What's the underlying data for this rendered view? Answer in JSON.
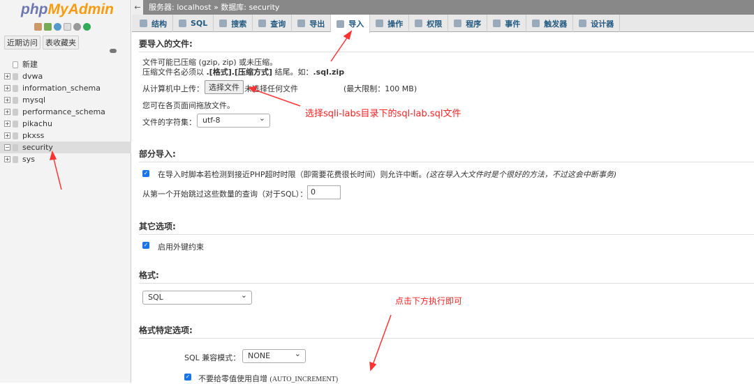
{
  "sidebar": {
    "logo_a": "php",
    "logo_b": "MyAdmin",
    "recent": "近期访问",
    "favorites": "表收藏夹",
    "tree": [
      "新建",
      "dvwa",
      "information_schema",
      "mysql",
      "performance_schema",
      "pikachu",
      "pkxss",
      "security",
      "sys"
    ],
    "selected": "security"
  },
  "topbar": {
    "crumb": "服务器: localhost » 数据库: security"
  },
  "tabs": [
    "结构",
    "SQL",
    "搜索",
    "查询",
    "导出",
    "导入",
    "操作",
    "权限",
    "程序",
    "事件",
    "触发器",
    "设计器"
  ],
  "active_tab": "导入",
  "file_section": {
    "heading": "要导入的文件:",
    "line1": "文件可能已压缩 (gzip, zip) 或未压缩。",
    "line2_a": "压缩文件名必须以 ",
    "line2_b": ".[格式].[压缩方式]",
    "line2_c": " 结尾。如：",
    "line2_d": ".sql.zip",
    "upload_label": "从计算机中上传：",
    "choose_btn": "选择文件",
    "no_file": "未选择任何文件",
    "max": "(最大限制：100 MB)",
    "drag": "您可在各页面间拖放文件。",
    "charset_label": "文件的字符集：",
    "charset": "utf-8"
  },
  "partial": {
    "heading": "部分导入:",
    "allow_interrupt": "在导入时脚本若检测到接近PHP超时时限（即需要花费很长时间）则允许中断。",
    "hint": "(这在导入大文件时是个很好的方法，不过这会中断事务)",
    "skip_label": "从第一个开始跳过这些数量的查询（对于SQL）：",
    "skip_value": "0"
  },
  "other": {
    "heading": "其它选项:",
    "fk": "启用外键约束"
  },
  "format": {
    "heading": "格式:",
    "value": "SQL"
  },
  "specific": {
    "heading": "格式特定选项:",
    "compat_label": "SQL 兼容模式：",
    "compat": "NONE",
    "auto_inc_a": "不要给零值使用自增 ",
    "auto_inc_b": "(AUTO_INCREMENT)"
  },
  "annotations": {
    "choose": "选择sqli-labs目录下的sql-lab.sql文件",
    "click": "点击下方执行即可"
  }
}
